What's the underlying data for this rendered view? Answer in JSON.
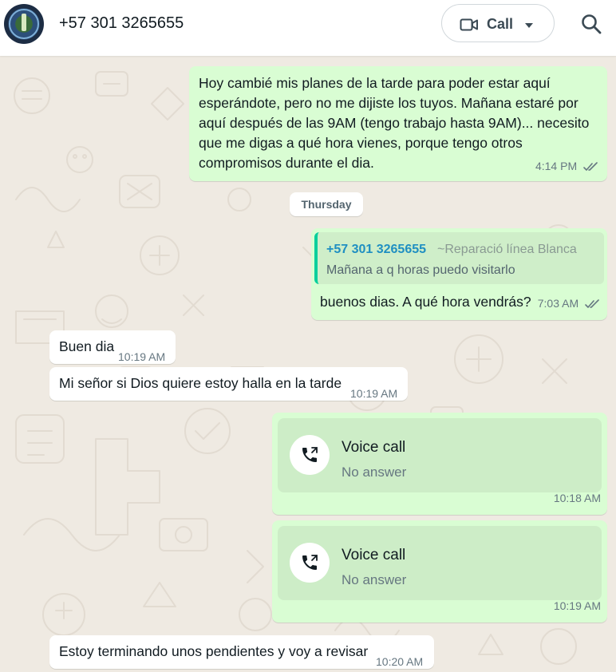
{
  "header": {
    "contact_name": "+57 301 3265655",
    "call_label": "Call",
    "icons": [
      "avatar",
      "video-camera-icon",
      "chevron-down-icon",
      "search-icon"
    ]
  },
  "messages": [
    {
      "direction": "out",
      "text": "Hoy cambié mis planes de la tarde para poder estar aquí esperándote, pero no me dijiste los tuyos. Mañana estaré por aquí después de las 9AM (tengo trabajo hasta 9AM)... necesito que me digas a qué hora vienes, porque tengo otros compromisos durante el dia.",
      "time": "4:14 PM",
      "status": "read"
    },
    {
      "divider": "Thursday"
    },
    {
      "direction": "out",
      "quote": {
        "name": "+57 301 3265655",
        "subtitle": "~Reparació línea Blanca",
        "text": "Mañana a q horas puedo visitarlo"
      },
      "text": "buenos dias. A qué hora vendrás?",
      "time": "7:03 AM",
      "status": "read"
    },
    {
      "direction": "in",
      "text": "Buen dia",
      "time": "10:19 AM"
    },
    {
      "direction": "in",
      "text": "Mi señor si Dios quiere estoy halla en la tarde",
      "time": "10:19 AM"
    },
    {
      "direction": "out",
      "type": "voice-call",
      "title": "Voice call",
      "subtitle": "No answer",
      "time": "10:18 AM"
    },
    {
      "direction": "out",
      "type": "voice-call",
      "title": "Voice call",
      "subtitle": "No answer",
      "time": "10:19 AM"
    },
    {
      "direction": "in",
      "text": "Estoy terminando unos pendientes y voy a revisar",
      "time": "10:20 AM"
    }
  ],
  "colors": {
    "chat_background": "#efeae2",
    "outgoing_bubble": "#d9fdd3",
    "incoming_bubble": "#ffffff",
    "read_ticks": "#667781",
    "quote_bar": "#06cf9c"
  }
}
